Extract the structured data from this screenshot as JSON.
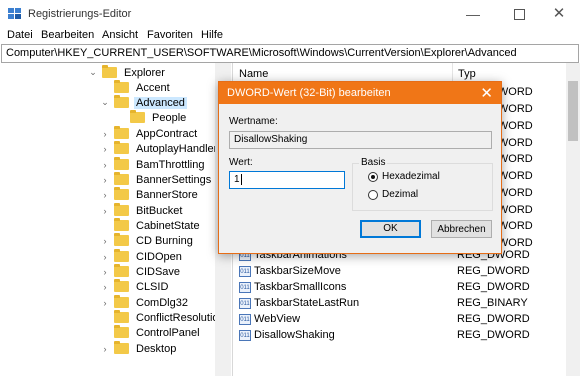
{
  "window": {
    "title": "Registrierungs-Editor"
  },
  "menu": [
    "Datei",
    "Bearbeiten",
    "Ansicht",
    "Favoriten",
    "Hilfe"
  ],
  "address": "Computer\\HKEY_CURRENT_USER\\SOFTWARE\\Microsoft\\Windows\\CurrentVersion\\Explorer\\Advanced",
  "tree": [
    {
      "label": "Explorer",
      "expanded": true
    },
    {
      "label": "Accent"
    },
    {
      "label": "Advanced",
      "expanded": true,
      "selected": true
    },
    {
      "label": "People"
    },
    {
      "label": "AppContract"
    },
    {
      "label": "AutoplayHandlers"
    },
    {
      "label": "BamThrottling"
    },
    {
      "label": "BannerSettings"
    },
    {
      "label": "BannerStore"
    },
    {
      "label": "BitBucket"
    },
    {
      "label": "CabinetState"
    },
    {
      "label": "CD Burning"
    },
    {
      "label": "CIDOpen"
    },
    {
      "label": "CIDSave"
    },
    {
      "label": "CLSID"
    },
    {
      "label": "ComDlg32"
    },
    {
      "label": "ConflictResolution"
    },
    {
      "label": "ControlPanel"
    },
    {
      "label": "Desktop"
    }
  ],
  "list": {
    "col_name": "Name",
    "col_type": "Typ",
    "type_column_behind_dialog": [
      "REG_DWORD",
      "REG_DWORD",
      "REG_DWORD",
      "REG_DWORD",
      "REG_DWORD",
      "REG_DWORD",
      "REG_DWORD",
      "REG_DWORD",
      "REG_DWORD",
      "REG_DWORD"
    ],
    "rows": [
      {
        "name": "TaskbarAnimations",
        "type": "REG_DWORD",
        "icon": "dword-value-icon"
      },
      {
        "name": "TaskbarSizeMove",
        "type": "REG_DWORD",
        "icon": "dword-value-icon"
      },
      {
        "name": "TaskbarSmallIcons",
        "type": "REG_DWORD",
        "icon": "dword-value-icon"
      },
      {
        "name": "TaskbarStateLastRun",
        "type": "REG_BINARY",
        "icon": "binary-value-icon"
      },
      {
        "name": "WebView",
        "type": "REG_DWORD",
        "icon": "dword-value-icon"
      },
      {
        "name": "DisallowShaking",
        "type": "REG_DWORD",
        "icon": "dword-value-icon"
      }
    ]
  },
  "dialog": {
    "title": "DWORD-Wert (32-Bit) bearbeiten",
    "name_label": "Wertname:",
    "name_value": "DisallowShaking",
    "data_label": "Wert:",
    "data_value": "1",
    "base_label": "Basis",
    "radio_hex": "Hexadezimal",
    "radio_dec": "Dezimal",
    "selected_base": "Hexadezimal",
    "ok": "OK",
    "cancel": "Abbrechen",
    "accent_color": "#f07617"
  }
}
